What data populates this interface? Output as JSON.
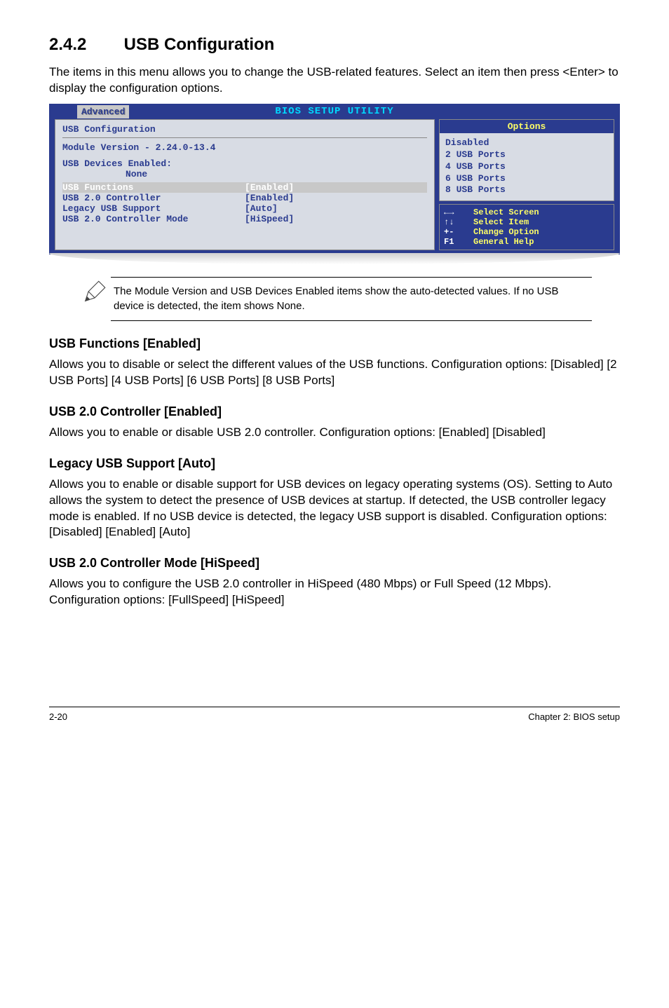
{
  "section": {
    "number": "2.4.2",
    "title": "USB Configuration",
    "intro": "The items in this menu allows you to change the USB-related features. Select an item then press <Enter> to display the configuration options."
  },
  "bios": {
    "setup_title": "BIOS SETUP UTILITY",
    "tab": "Advanced",
    "left_header": "USB Configuration",
    "module_version_line": "Module Version - 2.24.0-13.4",
    "devices_enabled_label": "USB Devices Enabled:",
    "devices_enabled_value": "None",
    "rows": [
      {
        "label": "USB Functions",
        "value": "[Enabled]",
        "highlight": true
      },
      {
        "label": "USB 2.0 Controller",
        "value": "[Enabled]",
        "highlight": false
      },
      {
        "label": "Legacy USB Support",
        "value": "[Auto]",
        "highlight": false
      },
      {
        "label": "USB 2.0 Controller Mode",
        "value": "[HiSpeed]",
        "highlight": false
      }
    ],
    "options_header": "Options",
    "options": [
      "Disabled",
      "2 USB Ports",
      "4 USB Ports",
      "6 USB Ports",
      "8 USB Ports"
    ],
    "help": [
      {
        "sym": "←→",
        "txt": "Select Screen"
      },
      {
        "sym": "↑↓",
        "txt": "Select Item"
      },
      {
        "sym": "+-",
        "txt": "Change Option"
      },
      {
        "sym": "F1",
        "txt": "General Help"
      }
    ]
  },
  "note": {
    "text": "The Module Version and USB Devices Enabled items show the auto-detected values. If no USB device is detected, the item shows None."
  },
  "subsections": [
    {
      "heading": "USB Functions [Enabled]",
      "body": "Allows you to disable or select the different values of the USB functions. Configuration options: [Disabled] [2 USB Ports] [4 USB Ports] [6 USB Ports] [8 USB Ports]"
    },
    {
      "heading": "USB 2.0 Controller [Enabled]",
      "body": "Allows you to enable or disable USB 2.0 controller. Configuration options: [Enabled] [Disabled]"
    },
    {
      "heading": "Legacy USB Support [Auto]",
      "body": "Allows you to enable or disable support for USB devices on legacy operating systems (OS). Setting to Auto allows the system to detect the presence of USB devices at startup. If detected, the USB controller legacy mode is enabled. If no USB device is detected, the legacy USB support is disabled. Configuration options: [Disabled] [Enabled] [Auto]"
    },
    {
      "heading": "USB 2.0 Controller Mode [HiSpeed]",
      "body": "Allows you to configure the USB 2.0 controller in HiSpeed (480 Mbps) or Full Speed (12 Mbps). Configuration options: [FullSpeed] [HiSpeed]"
    }
  ],
  "footer": {
    "left": "2-20",
    "right": "Chapter 2: BIOS setup"
  }
}
